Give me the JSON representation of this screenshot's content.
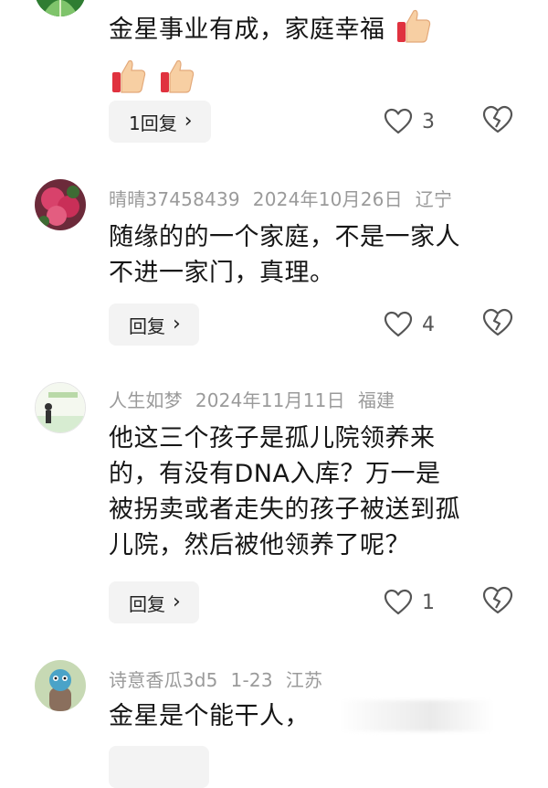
{
  "comments": [
    {
      "user": "",
      "date": "",
      "region": "",
      "text_lines": [
        "金星事业有成，家庭幸福"
      ],
      "reply_label": "1回复",
      "likes": "3",
      "avatar_icon": "leaf-avatar-icon"
    },
    {
      "user": "晴晴37458439",
      "date": "2024年10月26日",
      "region": "辽宁",
      "text_lines": [
        "随缘的的一个家庭，不是一家人",
        "不进一家门，真理。"
      ],
      "reply_label": "回复",
      "likes": "4",
      "avatar_icon": "flower-avatar-icon"
    },
    {
      "user": "人生如梦",
      "date": "2024年11月11日",
      "region": "福建",
      "text_lines": [
        "他这三个孩子是孤儿院领养来",
        "的，有没有DNA入库？万一是",
        "被拐卖或者走失的孩子被送到孤",
        "儿院，然后被他领养了呢？"
      ],
      "reply_label": "回复",
      "likes": "1",
      "avatar_icon": "scene-avatar-icon"
    },
    {
      "user": "诗意香瓜3d5",
      "date": "1-23",
      "region": "江苏",
      "text_lines": [
        "金星是个能干人，"
      ],
      "reply_label": "",
      "likes": "",
      "avatar_icon": "cartoon-avatar-icon"
    }
  ],
  "icons": {
    "chevron": "›",
    "like": "heart-outline-icon",
    "dislike": "broken-heart-icon",
    "thumb": "thumbs-up-emoji-icon"
  },
  "colors": {
    "meta": "#9a9a9a",
    "reply_bg": "#f3f3f3",
    "text": "#161616"
  }
}
